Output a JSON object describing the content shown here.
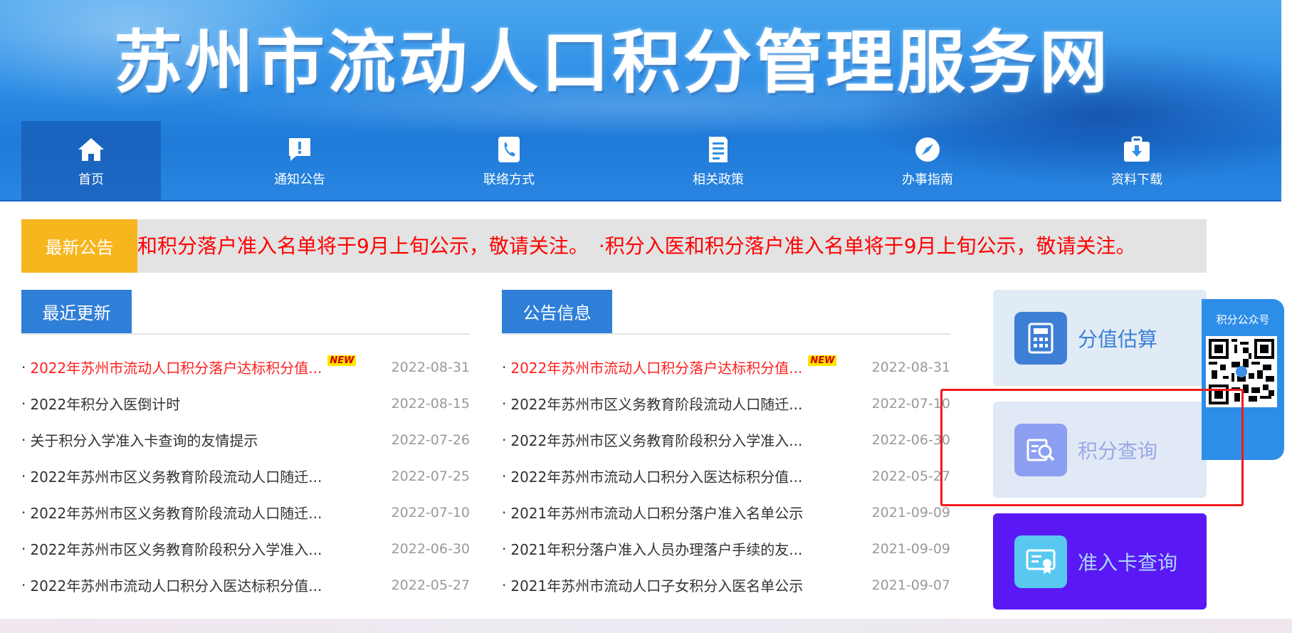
{
  "banner": {
    "title": "苏州市流动人口积分管理服务网"
  },
  "nav": [
    {
      "label": "首页",
      "icon": "home-icon"
    },
    {
      "label": "通知公告",
      "icon": "notice-icon"
    },
    {
      "label": "联络方式",
      "icon": "phone-icon"
    },
    {
      "label": "相关政策",
      "icon": "document-icon"
    },
    {
      "label": "办事指南",
      "icon": "compass-icon"
    },
    {
      "label": "资料下载",
      "icon": "download-icon"
    }
  ],
  "notice": {
    "label": "最新公告",
    "text": "和积分落户准入名单将于9月上旬公示，敬请关注。　·积分入医和积分落户准入名单将于9月上旬公示，敬请关注。"
  },
  "recent": {
    "title": "最近更新",
    "items": [
      {
        "title": "2022年苏州市流动人口积分落户达标积分值...",
        "date": "2022-08-31",
        "new": "NEW"
      },
      {
        "title": "2022年积分入医倒计时",
        "date": "2022-08-15"
      },
      {
        "title": "关于积分入学准入卡查询的友情提示",
        "date": "2022-07-26"
      },
      {
        "title": "2022年苏州市区义务教育阶段流动人口随迁...",
        "date": "2022-07-25"
      },
      {
        "title": "2022年苏州市区义务教育阶段流动人口随迁...",
        "date": "2022-07-10"
      },
      {
        "title": "2022年苏州市区义务教育阶段积分入学准入...",
        "date": "2022-06-30"
      },
      {
        "title": "2022年苏州市流动人口积分入医达标积分值...",
        "date": "2022-05-27"
      }
    ]
  },
  "announce": {
    "title": "公告信息",
    "items": [
      {
        "title": "2022年苏州市流动人口积分落户达标积分值...",
        "date": "2022-08-31",
        "new": "NEW"
      },
      {
        "title": "2022年苏州市区义务教育阶段流动人口随迁...",
        "date": "2022-07-10"
      },
      {
        "title": "2022年苏州市区义务教育阶段积分入学准入...",
        "date": "2022-06-30"
      },
      {
        "title": "2022年苏州市流动人口积分入医达标积分值...",
        "date": "2022-05-27"
      },
      {
        "title": "2021年苏州市流动人口积分落户准入名单公示",
        "date": "2021-09-09"
      },
      {
        "title": "2021年积分落户准入人员办理落户手续的友...",
        "date": "2021-09-09"
      },
      {
        "title": "2021年苏州市流动人口子女积分入医名单公示",
        "date": "2021-09-07"
      }
    ]
  },
  "side": {
    "estimate": "分值估算",
    "query": "积分查询",
    "card": "准入卡查询"
  },
  "qr": {
    "title": "积分公众号"
  },
  "colors": {
    "accent": "#2f7fd8",
    "notice_label": "#f7b51e",
    "notice_text": "#ff0000",
    "card_btn": "#5a18f5"
  }
}
